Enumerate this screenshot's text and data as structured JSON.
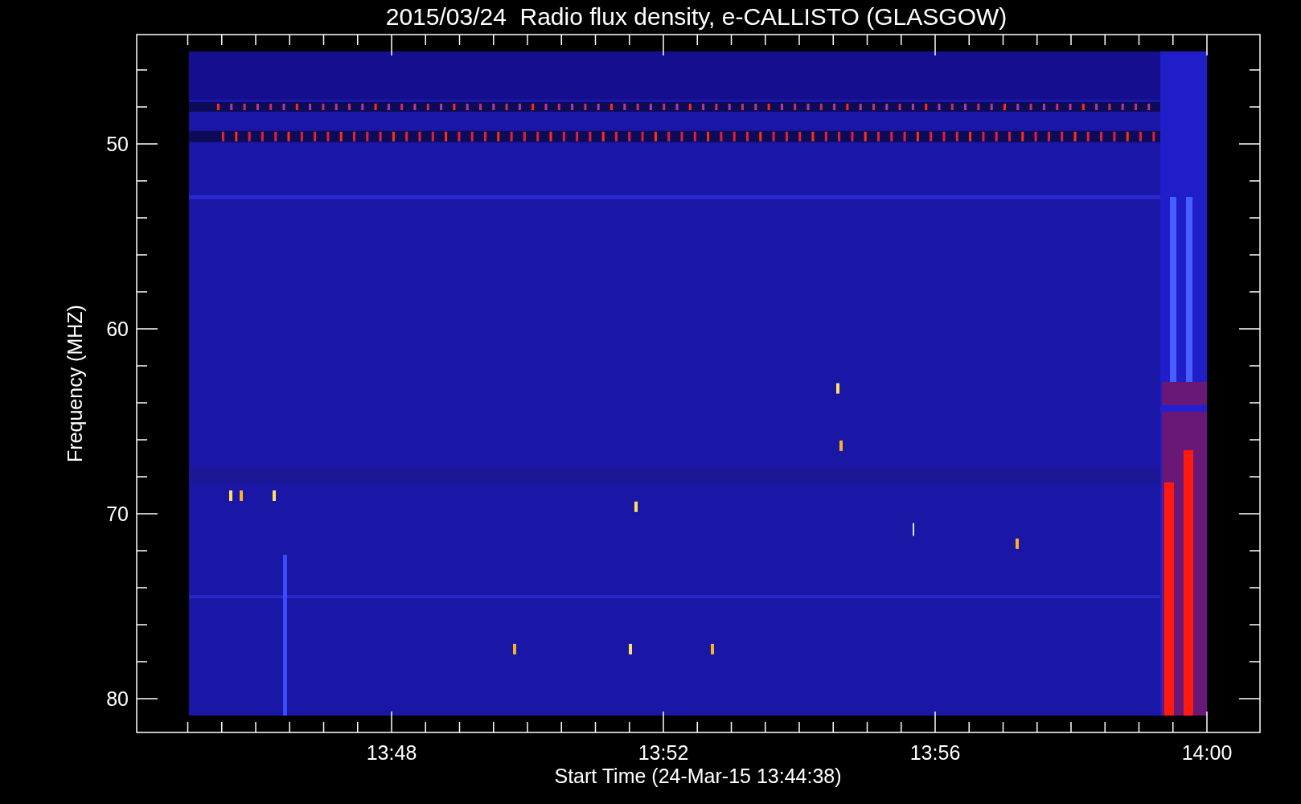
{
  "title": "2015/03/24  Radio flux density, e-CALLISTO (GLASGOW)",
  "y_axis": {
    "label": "Frequency (MHZ)",
    "ticks": [
      "50",
      "60",
      "70",
      "80"
    ]
  },
  "x_axis": {
    "label": "Start Time (24-Mar-15 13:44:38)",
    "ticks": [
      "13:48",
      "13:52",
      "13:56",
      "14:00"
    ]
  }
}
